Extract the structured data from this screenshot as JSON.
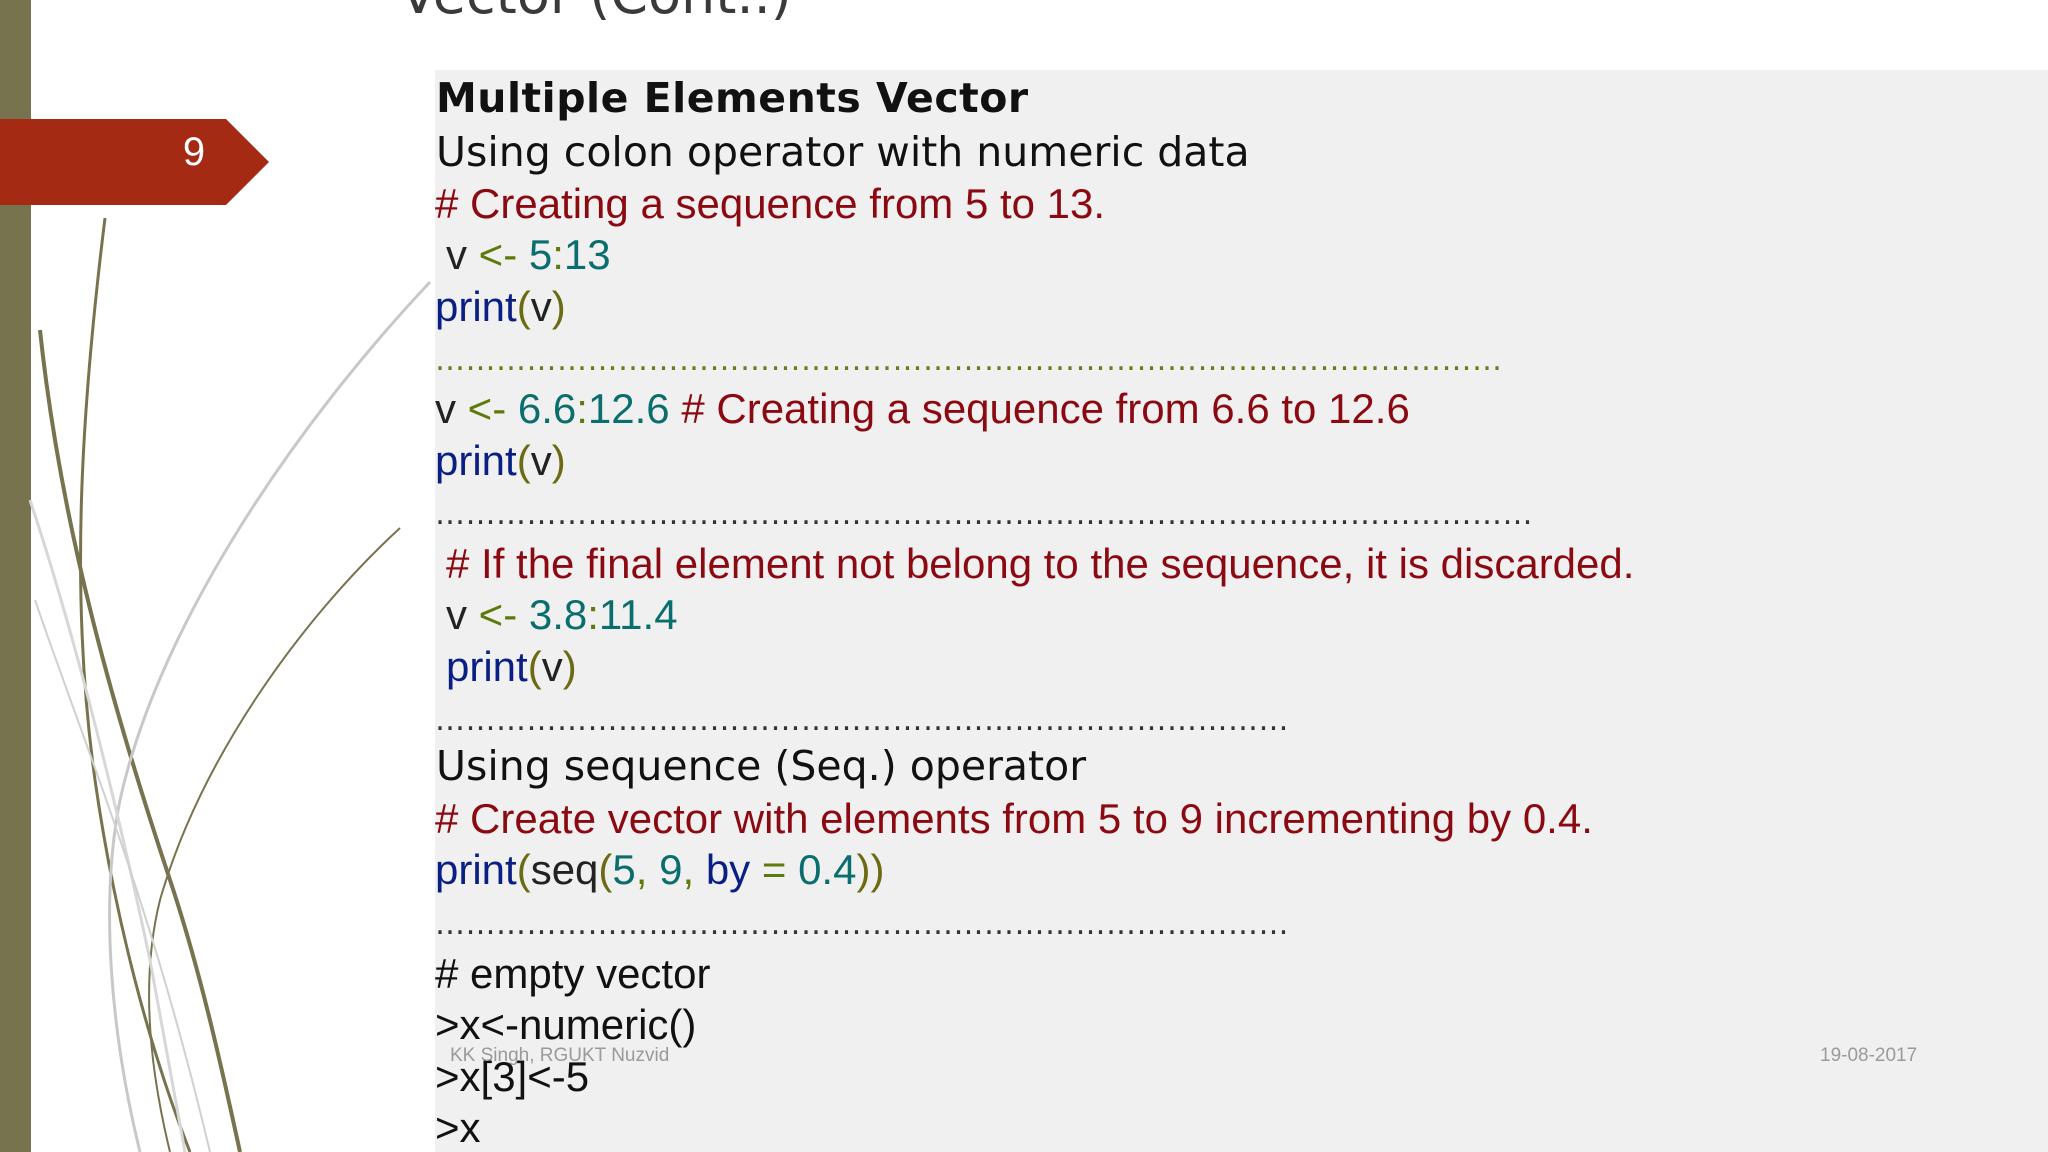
{
  "slide": {
    "number": "9",
    "title": "Vector (Cont..)"
  },
  "content": {
    "heading": "Multiple Elements Vector",
    "subheading1": "Using colon operator with numeric data",
    "comment1": "# Creating a sequence from 5 to 13.",
    "code1": {
      "var": "v",
      "assign": "<-",
      "from": "5",
      "sep": ":",
      "to": "13"
    },
    "print1": {
      "fn": "print",
      "open": "(",
      "arg": "v",
      "close": ")"
    },
    "separator1": "……………………………………………………………………………………………",
    "code2": {
      "var": "v",
      "assign": "<-",
      "from": "6.6",
      "sep": ":",
      "to": "12.6",
      "comment": "# Creating a sequence from 6.6 to 12.6"
    },
    "print2": {
      "fn": "print",
      "open": "(",
      "arg": "v",
      "close": ")"
    },
    "separator2": "………………………………………………………………………………………………",
    "comment3": "# If the final element  not belong to the sequence, it is discarded.",
    "code3": {
      "var": "v",
      "assign": "<-",
      "from": "3.8",
      "sep": ":",
      "to": "11.4"
    },
    "print3": {
      "fn": "print",
      "open": "(",
      "arg": "v",
      "close": ")"
    },
    "separator3": "…………………………………………………………………………",
    "subheading2": "Using sequence (Seq.) operator",
    "comment4": "# Create vector with elements from 5 to 9 incrementing by 0.4.",
    "code4": {
      "fn": "print",
      "open": "(",
      "seq": "seq",
      "open2": "(",
      "a": "5",
      "comma1": ",",
      "b": "9",
      "comma2": ",",
      "by": "by",
      "eq": "=",
      "step": "0.4",
      "close": "))"
    },
    "separator4": "…………………………………………………………………………",
    "comment5": "# empty vector",
    "line_x1": ">x<-numeric()",
    "line_x2": ">x[3]<-5",
    "line_x3": ">x"
  },
  "footer": {
    "author": "KK Singh, RGUKT Nuzvid",
    "date": "19-08-2017"
  },
  "colors": {
    "side_bar": "#77734f",
    "number_tab": "#a52a14",
    "content_bg": "#f0f0f0",
    "comment": "#8b0a12",
    "function": "#0a1f84",
    "number": "#0b6e6e"
  }
}
